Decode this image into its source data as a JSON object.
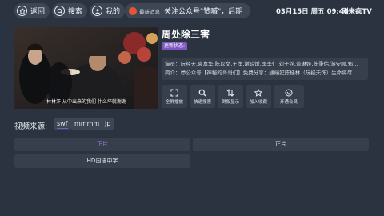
{
  "topbar": {
    "back_label": "返回",
    "search_label": "搜索",
    "mine_label": "我的",
    "news_tag": "最新消息",
    "news_text": "关注公众号\"赞嘁\"，后期",
    "clock": "03月15日 周五 09:40",
    "brand": "剧来疯TV"
  },
  "player": {
    "subtitle": "林林汗 从中出来的我们 什么坏就谢谢"
  },
  "detail": {
    "title": "周处除三害",
    "badge": "更新状态:",
    "cast_line": "演员：阮经天,袁富华,陈以文,王净,谢琼煖,李李仁,刘子铨,普琳娅,陈秉佑,游安顺,郑...",
    "intro_line": "简介：😎公众号【神秘的哥哥们】免费分享：通缉犯陈桂林（阮经天饰）生命将尽..."
  },
  "actions": [
    {
      "label": "全屏播放",
      "icon": "fullscreen-icon"
    },
    {
      "label": "快速搜索",
      "icon": "search-icon"
    },
    {
      "label": "倒叙显示",
      "icon": "sort-icon"
    },
    {
      "label": "加入收藏",
      "icon": "star-icon"
    },
    {
      "label": "开通会员",
      "icon": "vip-icon"
    }
  ],
  "sources": {
    "label": "视频来源:",
    "items": [
      "swf",
      "mmmm",
      "jp"
    ],
    "active": "swf"
  },
  "episodes": [
    {
      "label": "正片",
      "active": true
    },
    {
      "label": "正片",
      "active": false
    },
    {
      "label": "HD国语中字",
      "active": false
    }
  ],
  "colors": {
    "background": "#2b3340",
    "panel": "#373f4c",
    "accent": "#7e57c2",
    "news_dot": "#e8552f"
  }
}
